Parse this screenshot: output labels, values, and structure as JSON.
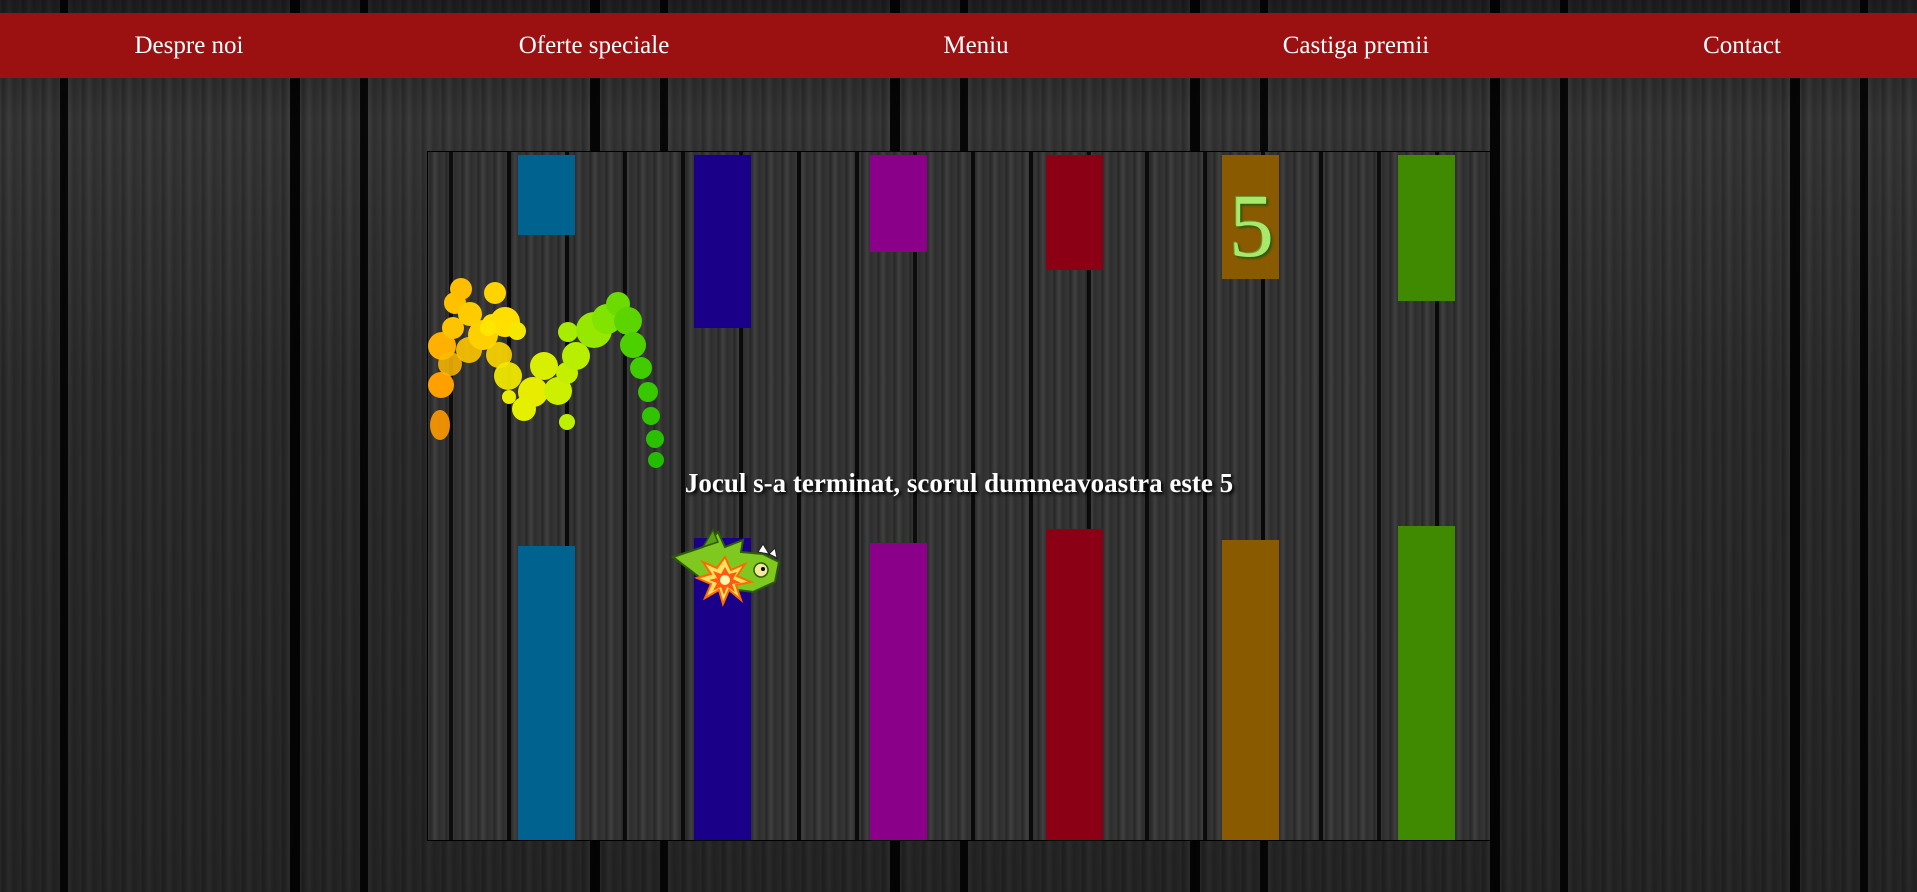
{
  "nav": {
    "items": [
      "Despre noi",
      "Oferte speciale",
      "Meniu",
      "Castiga premii",
      "Contact"
    ]
  },
  "game": {
    "score": "5",
    "game_over_message": "Jocul s-a terminat, scorul dumneavoastra este 5",
    "colors": {
      "nav_bar": "#9b1010",
      "pipes": [
        "#00628e",
        "#1a0088",
        "#8a0088",
        "#8b0014",
        "#8a5a00",
        "#3f8a00"
      ],
      "score_text": "#a8e86a",
      "message_text": "#ffffff"
    },
    "icons": [
      "dragon-icon",
      "explosion-icon"
    ]
  }
}
